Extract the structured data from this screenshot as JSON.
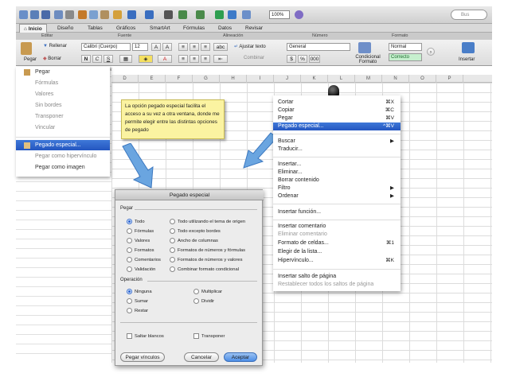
{
  "toolbar": {
    "zoom": "100%",
    "search_placeholder": "Bus"
  },
  "tabs": [
    "Inicio",
    "Diseño",
    "Tablas",
    "Gráficos",
    "SmartArt",
    "Fórmulas",
    "Datos",
    "Revisar"
  ],
  "groups": [
    "Editar",
    "Fuente",
    "Alineación",
    "Número",
    "Formato"
  ],
  "ribbon": {
    "paste_label": "Pegar",
    "fill_label": "Rellenar",
    "clear_label": "Borrar",
    "font_name": "Calibri (Cuerpo)",
    "font_size": "12",
    "bold": "N",
    "italic": "C",
    "underline": "S",
    "wrap_text": "Ajustar texto",
    "merge": "Combinar",
    "number_format": "General",
    "conditional_format": "Condicional Formato",
    "style_normal": "Normal",
    "style_correct": "Correcto",
    "insert_label": "Insertar",
    "abc": "abc"
  },
  "name_box_suffix": "fx",
  "columns": [
    "D",
    "E",
    "F",
    "G",
    "H",
    "I",
    "J",
    "K",
    "L",
    "M",
    "N",
    "O",
    "P"
  ],
  "paste_menu": {
    "items": [
      {
        "label": "Pegar",
        "state": "normal"
      },
      {
        "label": "Fórmulas",
        "state": "gray"
      },
      {
        "label": "Valores",
        "state": "gray"
      },
      {
        "label": "Sin bordes",
        "state": "gray"
      },
      {
        "label": "Transponer",
        "state": "gray"
      },
      {
        "label": "Vincular",
        "state": "gray"
      },
      {
        "label": "Pegado especial...",
        "state": "selected"
      },
      {
        "label": "Pegar como hipervínculo",
        "state": "gray"
      },
      {
        "label": "Pegar como imagen",
        "state": "normal"
      }
    ]
  },
  "callout": {
    "text": "La opción pegado especial facilita el acceso a su vez a otra ventana, donde me permite elegir entre las distintas opciones de pegado"
  },
  "context_menu": {
    "items": [
      {
        "label": "Cortar",
        "shortcut": "⌘X",
        "state": "normal"
      },
      {
        "label": "Copiar",
        "shortcut": "⌘C",
        "state": "normal"
      },
      {
        "label": "Pegar",
        "shortcut": "⌘V",
        "state": "normal"
      },
      {
        "label": "Pegado especial...",
        "shortcut": "^⌘V",
        "state": "selected"
      },
      {
        "label": "Buscar",
        "shortcut": "▶",
        "state": "normal"
      },
      {
        "label": "Traducir...",
        "shortcut": "",
        "state": "normal"
      },
      {
        "label": "Insertar...",
        "shortcut": "",
        "state": "normal"
      },
      {
        "label": "Eliminar...",
        "shortcut": "",
        "state": "normal"
      },
      {
        "label": "Borrar contenido",
        "shortcut": "",
        "state": "normal"
      },
      {
        "label": "Filtro",
        "shortcut": "▶",
        "state": "normal"
      },
      {
        "label": "Ordenar",
        "shortcut": "▶",
        "state": "normal"
      },
      {
        "label": "Insertar función...",
        "shortcut": "",
        "state": "normal"
      },
      {
        "label": "Insertar comentario",
        "shortcut": "",
        "state": "normal"
      },
      {
        "label": "Eliminar comentario",
        "shortcut": "",
        "state": "gray"
      },
      {
        "label": "Formato de celdas...",
        "shortcut": "⌘1",
        "state": "normal"
      },
      {
        "label": "Elegir de la lista...",
        "shortcut": "",
        "state": "normal"
      },
      {
        "label": "Hipervínculo...",
        "shortcut": "⌘K",
        "state": "normal"
      },
      {
        "label": "Insertar salto de página",
        "shortcut": "",
        "state": "normal"
      },
      {
        "label": "Restablecer todos los saltos de página",
        "shortcut": "",
        "state": "gray"
      }
    ]
  },
  "dialog": {
    "title": "Pegado especial",
    "paste_section": "Pegar",
    "paste_options_left": [
      "Todo",
      "Fórmulas",
      "Valores",
      "Formatos",
      "Comentarios",
      "Validación"
    ],
    "paste_options_right": [
      "Todo utilizando el tema de origen",
      "Todo excepto bordes",
      "Ancho de columnas",
      "Formatos de números y fórmulas",
      "Formatos de números y valores",
      "Combinar formato condicional"
    ],
    "operation_section": "Operación",
    "operation_options_left": [
      "Ninguna",
      "Sumar",
      "Restar"
    ],
    "operation_options_right": [
      "Multiplicar",
      "Dividir"
    ],
    "skip_blanks": "Saltar blancos",
    "transpose": "Transponer",
    "paste_links_button": "Pegar vínculos",
    "cancel_button": "Cancelar",
    "accept_button": "Aceptar"
  }
}
